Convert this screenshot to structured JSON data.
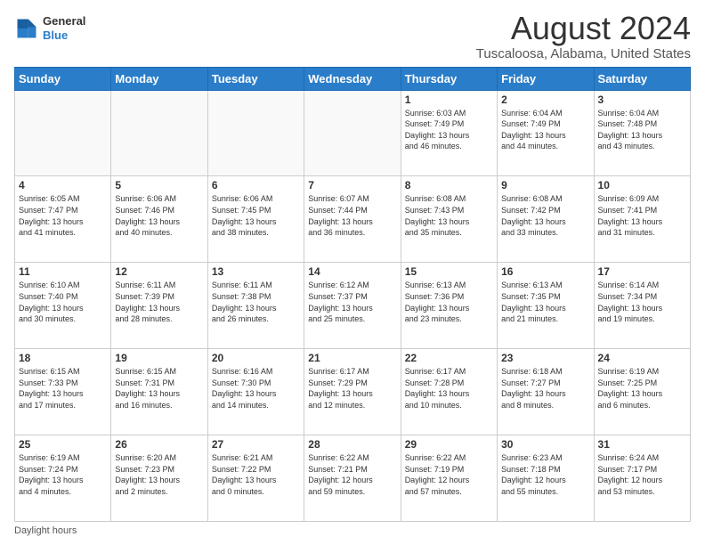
{
  "header": {
    "logo_line1": "General",
    "logo_line2": "Blue",
    "title": "August 2024",
    "subtitle": "Tuscaloosa, Alabama, United States"
  },
  "days_of_week": [
    "Sunday",
    "Monday",
    "Tuesday",
    "Wednesday",
    "Thursday",
    "Friday",
    "Saturday"
  ],
  "weeks": [
    [
      {
        "day": "",
        "info": ""
      },
      {
        "day": "",
        "info": ""
      },
      {
        "day": "",
        "info": ""
      },
      {
        "day": "",
        "info": ""
      },
      {
        "day": "1",
        "info": "Sunrise: 6:03 AM\nSunset: 7:49 PM\nDaylight: 13 hours\nand 46 minutes."
      },
      {
        "day": "2",
        "info": "Sunrise: 6:04 AM\nSunset: 7:49 PM\nDaylight: 13 hours\nand 44 minutes."
      },
      {
        "day": "3",
        "info": "Sunrise: 6:04 AM\nSunset: 7:48 PM\nDaylight: 13 hours\nand 43 minutes."
      }
    ],
    [
      {
        "day": "4",
        "info": "Sunrise: 6:05 AM\nSunset: 7:47 PM\nDaylight: 13 hours\nand 41 minutes."
      },
      {
        "day": "5",
        "info": "Sunrise: 6:06 AM\nSunset: 7:46 PM\nDaylight: 13 hours\nand 40 minutes."
      },
      {
        "day": "6",
        "info": "Sunrise: 6:06 AM\nSunset: 7:45 PM\nDaylight: 13 hours\nand 38 minutes."
      },
      {
        "day": "7",
        "info": "Sunrise: 6:07 AM\nSunset: 7:44 PM\nDaylight: 13 hours\nand 36 minutes."
      },
      {
        "day": "8",
        "info": "Sunrise: 6:08 AM\nSunset: 7:43 PM\nDaylight: 13 hours\nand 35 minutes."
      },
      {
        "day": "9",
        "info": "Sunrise: 6:08 AM\nSunset: 7:42 PM\nDaylight: 13 hours\nand 33 minutes."
      },
      {
        "day": "10",
        "info": "Sunrise: 6:09 AM\nSunset: 7:41 PM\nDaylight: 13 hours\nand 31 minutes."
      }
    ],
    [
      {
        "day": "11",
        "info": "Sunrise: 6:10 AM\nSunset: 7:40 PM\nDaylight: 13 hours\nand 30 minutes."
      },
      {
        "day": "12",
        "info": "Sunrise: 6:11 AM\nSunset: 7:39 PM\nDaylight: 13 hours\nand 28 minutes."
      },
      {
        "day": "13",
        "info": "Sunrise: 6:11 AM\nSunset: 7:38 PM\nDaylight: 13 hours\nand 26 minutes."
      },
      {
        "day": "14",
        "info": "Sunrise: 6:12 AM\nSunset: 7:37 PM\nDaylight: 13 hours\nand 25 minutes."
      },
      {
        "day": "15",
        "info": "Sunrise: 6:13 AM\nSunset: 7:36 PM\nDaylight: 13 hours\nand 23 minutes."
      },
      {
        "day": "16",
        "info": "Sunrise: 6:13 AM\nSunset: 7:35 PM\nDaylight: 13 hours\nand 21 minutes."
      },
      {
        "day": "17",
        "info": "Sunrise: 6:14 AM\nSunset: 7:34 PM\nDaylight: 13 hours\nand 19 minutes."
      }
    ],
    [
      {
        "day": "18",
        "info": "Sunrise: 6:15 AM\nSunset: 7:33 PM\nDaylight: 13 hours\nand 17 minutes."
      },
      {
        "day": "19",
        "info": "Sunrise: 6:15 AM\nSunset: 7:31 PM\nDaylight: 13 hours\nand 16 minutes."
      },
      {
        "day": "20",
        "info": "Sunrise: 6:16 AM\nSunset: 7:30 PM\nDaylight: 13 hours\nand 14 minutes."
      },
      {
        "day": "21",
        "info": "Sunrise: 6:17 AM\nSunset: 7:29 PM\nDaylight: 13 hours\nand 12 minutes."
      },
      {
        "day": "22",
        "info": "Sunrise: 6:17 AM\nSunset: 7:28 PM\nDaylight: 13 hours\nand 10 minutes."
      },
      {
        "day": "23",
        "info": "Sunrise: 6:18 AM\nSunset: 7:27 PM\nDaylight: 13 hours\nand 8 minutes."
      },
      {
        "day": "24",
        "info": "Sunrise: 6:19 AM\nSunset: 7:25 PM\nDaylight: 13 hours\nand 6 minutes."
      }
    ],
    [
      {
        "day": "25",
        "info": "Sunrise: 6:19 AM\nSunset: 7:24 PM\nDaylight: 13 hours\nand 4 minutes."
      },
      {
        "day": "26",
        "info": "Sunrise: 6:20 AM\nSunset: 7:23 PM\nDaylight: 13 hours\nand 2 minutes."
      },
      {
        "day": "27",
        "info": "Sunrise: 6:21 AM\nSunset: 7:22 PM\nDaylight: 13 hours\nand 0 minutes."
      },
      {
        "day": "28",
        "info": "Sunrise: 6:22 AM\nSunset: 7:21 PM\nDaylight: 12 hours\nand 59 minutes."
      },
      {
        "day": "29",
        "info": "Sunrise: 6:22 AM\nSunset: 7:19 PM\nDaylight: 12 hours\nand 57 minutes."
      },
      {
        "day": "30",
        "info": "Sunrise: 6:23 AM\nSunset: 7:18 PM\nDaylight: 12 hours\nand 55 minutes."
      },
      {
        "day": "31",
        "info": "Sunrise: 6:24 AM\nSunset: 7:17 PM\nDaylight: 12 hours\nand 53 minutes."
      }
    ]
  ],
  "footer": "Daylight hours"
}
